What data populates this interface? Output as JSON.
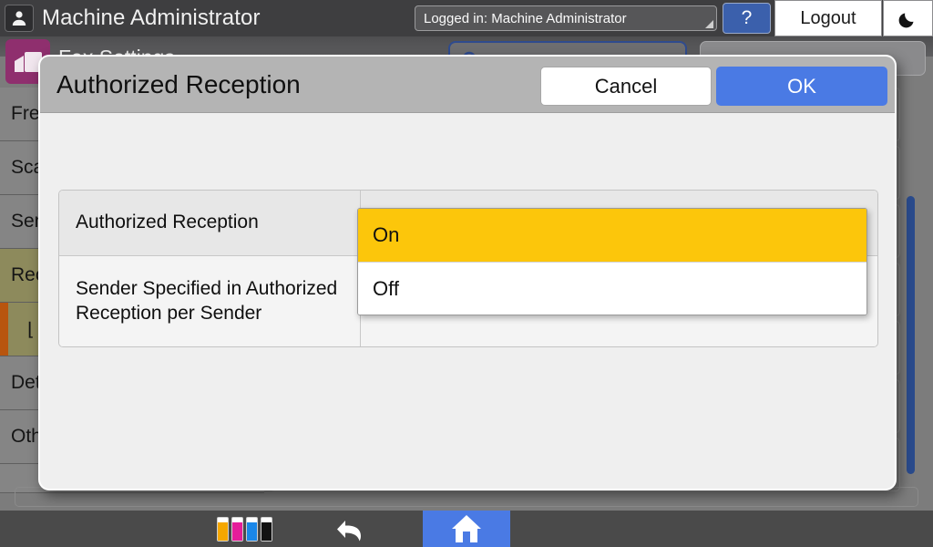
{
  "topbar": {
    "avatar_icon": "user-icon",
    "title": "Machine Administrator",
    "login_status": "Logged in: Machine Administrator",
    "help_label": "?",
    "logout_label": "Logout",
    "sleep_icon": "moon-icon"
  },
  "page": {
    "app_icon": "fax-icon",
    "title": "Fax Settings",
    "search_placeholder": "",
    "search_icon": "search-icon",
    "right_action_label": "",
    "sidebar": [
      {
        "label": "Frequently Used Settings",
        "selected": false,
        "sub": false
      },
      {
        "label": "Scan Settings",
        "selected": false,
        "sub": false
      },
      {
        "label": "Send Settings",
        "selected": false,
        "sub": false
      },
      {
        "label": "Reception Settings",
        "selected": true,
        "sub": false
      },
      {
        "label": "Reception Restrictions",
        "selected": true,
        "sub": true
      },
      {
        "label": "Detailed Settings",
        "selected": false,
        "sub": false
      },
      {
        "label": "Other Settings",
        "selected": false,
        "sub": false
      }
    ]
  },
  "modal": {
    "title": "Authorized Reception",
    "cancel_label": "Cancel",
    "ok_label": "OK",
    "rows": [
      {
        "label": "Authorized Reception",
        "value": ""
      },
      {
        "label": "Sender Specified in Authorized Reception per Sender",
        "value": ""
      }
    ],
    "dropdown": {
      "options": [
        {
          "label": "On",
          "selected": true
        },
        {
          "label": "Off",
          "selected": false
        }
      ]
    }
  },
  "bottombar": {
    "toner": [
      {
        "name": "toner-yellow",
        "color": "#f5a700"
      },
      {
        "name": "toner-magenta",
        "color": "#e51d9a"
      },
      {
        "name": "toner-cyan",
        "color": "#1b87e8"
      },
      {
        "name": "toner-black",
        "color": "#131313"
      }
    ],
    "undo_icon": "undo-arrow-icon",
    "home_icon": "home-icon"
  },
  "colors": {
    "accent_blue": "#4a7ae4",
    "highlight_yellow": "#fcc60b",
    "sidebar_selected": "#8d8a5c",
    "sidebar_marker": "#b8550e",
    "app_icon_magenta": "#8f2f6e",
    "scrollbar_blue": "#2a4b8d"
  }
}
